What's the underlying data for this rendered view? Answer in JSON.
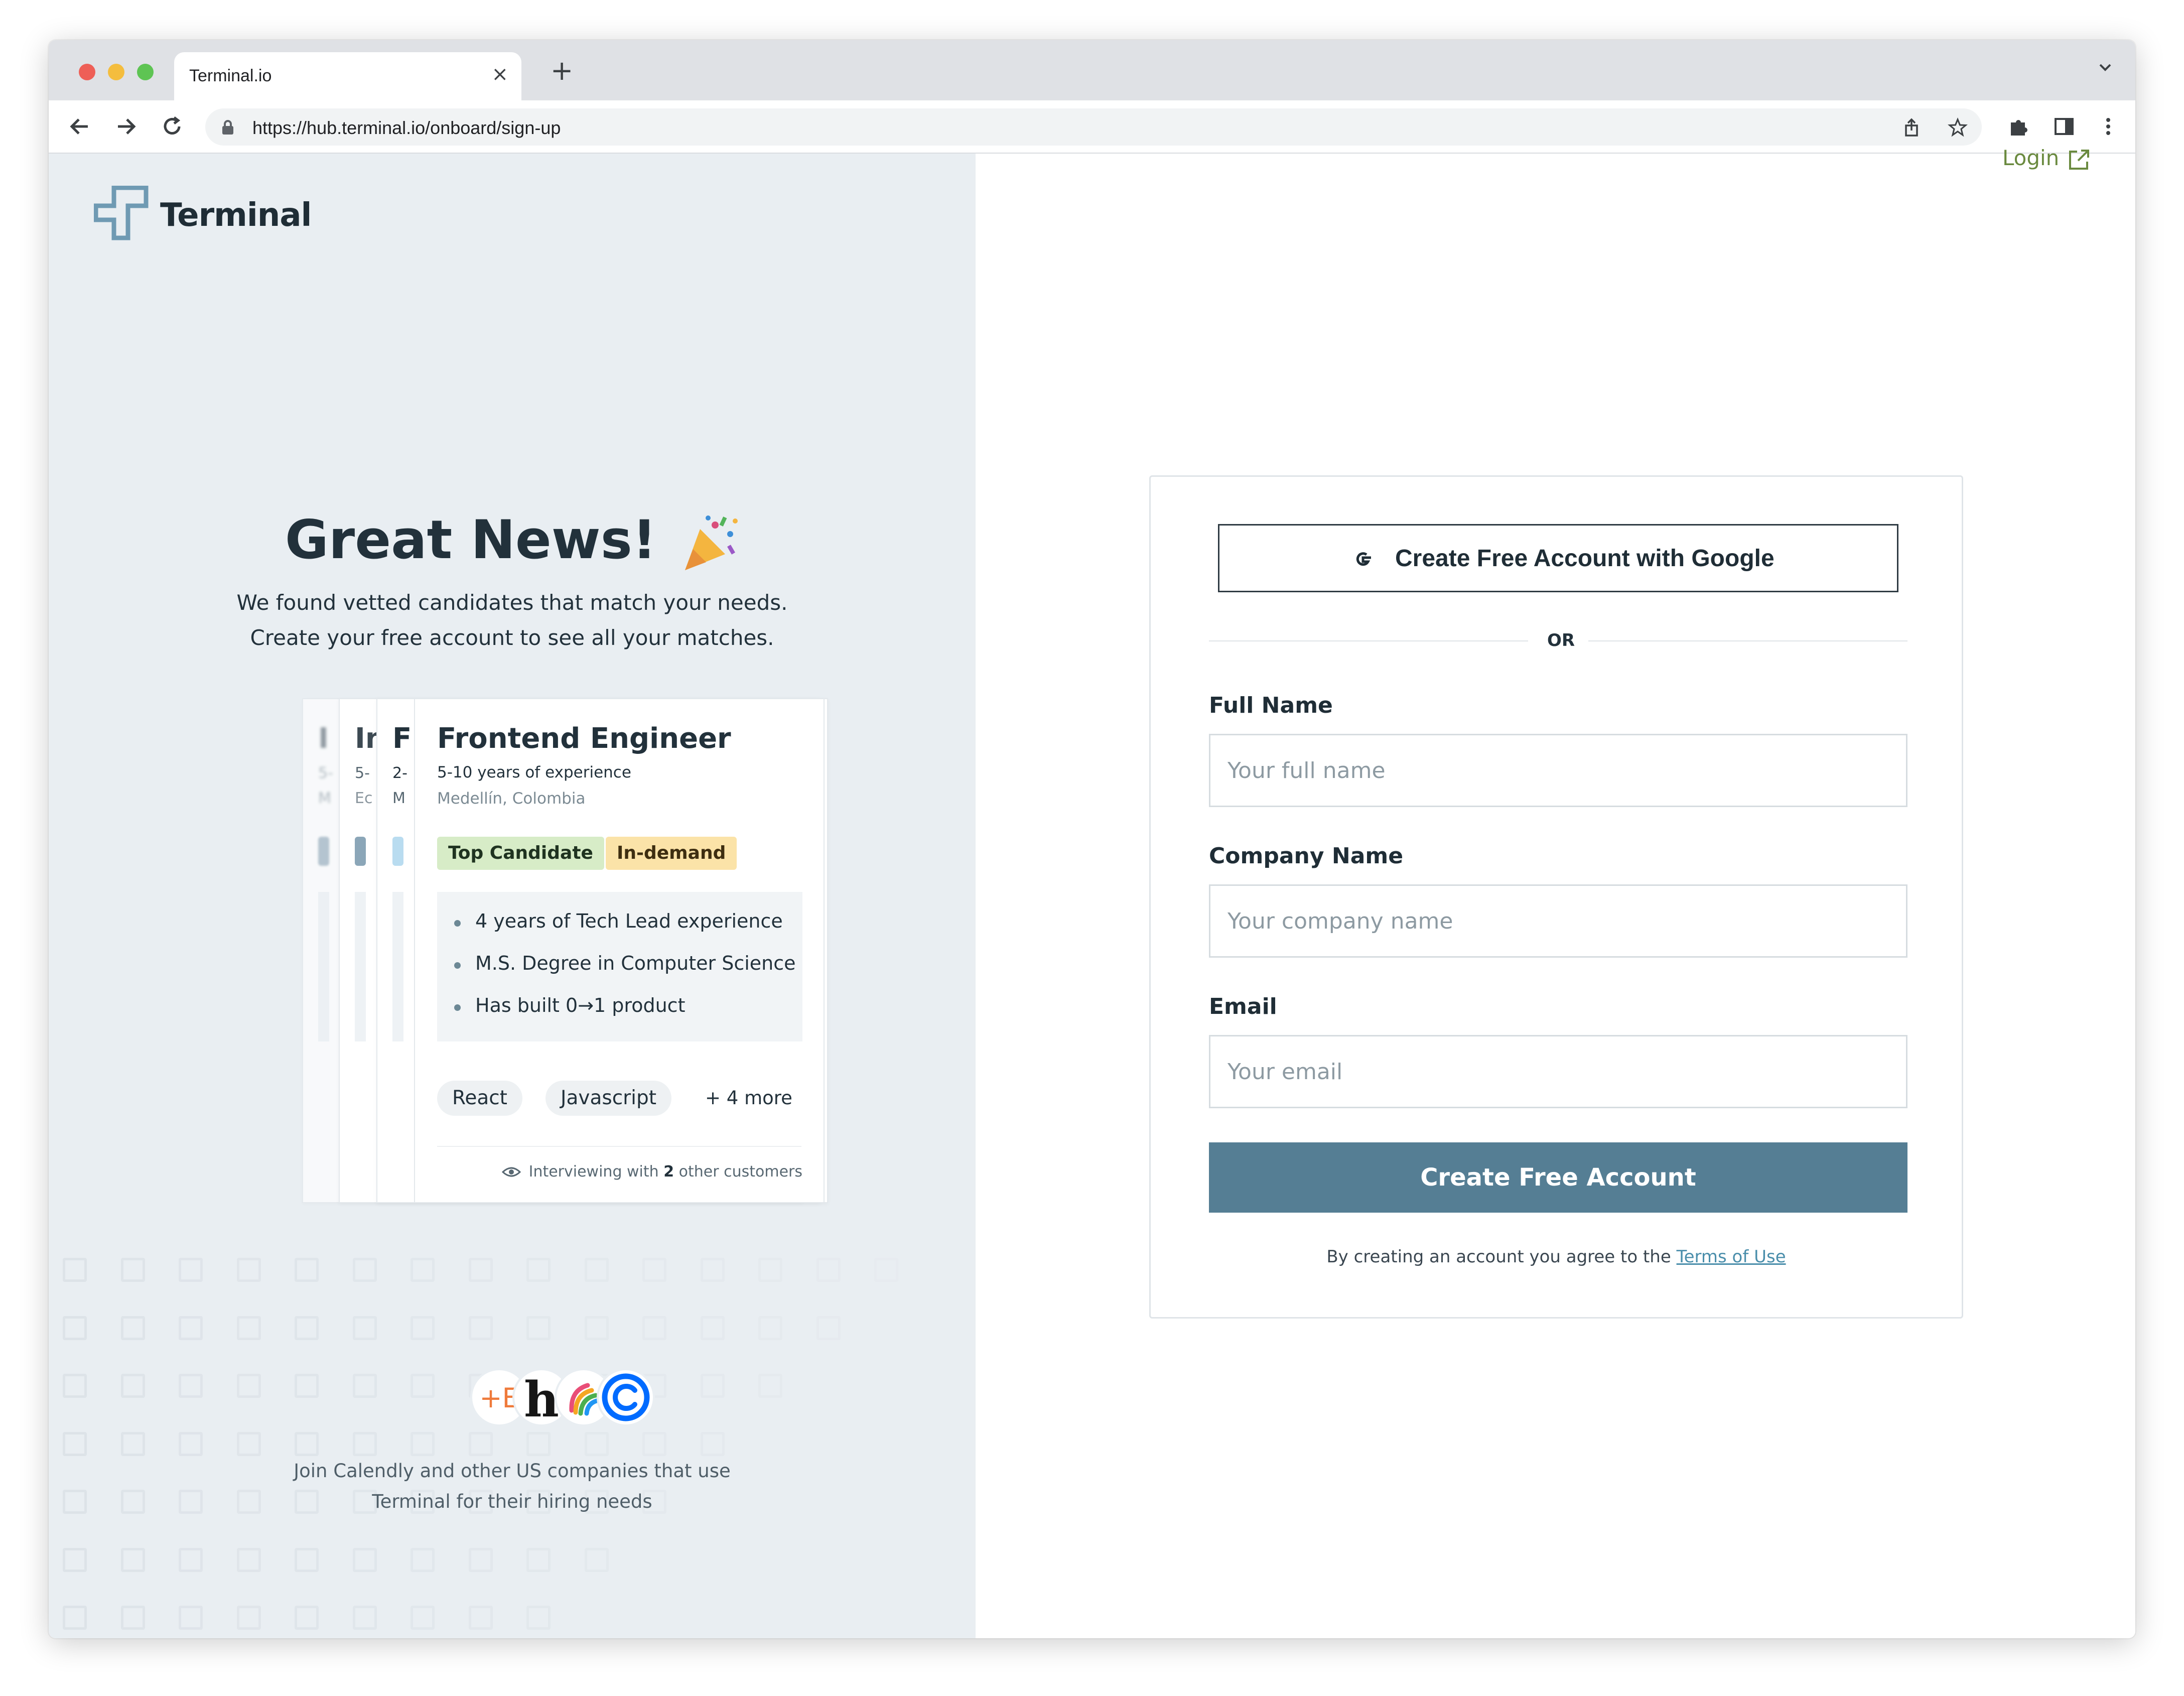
{
  "browser": {
    "tab_title": "Terminal.io",
    "tab_close": "×",
    "new_tab": "+",
    "url": "https://hub.terminal.io/onboard/sign-up"
  },
  "brand": {
    "name": "Terminal"
  },
  "hero": {
    "title": "Great News!",
    "subtitle_line1": "We found vetted candidates that match your needs.",
    "subtitle_line2": "Create your free account to see all your matches."
  },
  "candidate_card": {
    "title": "Frontend Engineer",
    "experience": "5-10 years of experience",
    "location": "Medellín, Colombia",
    "tags": [
      "Top Candidate",
      "In-demand"
    ],
    "highlights": [
      "4 years of Tech Lead experience",
      "M.S. Degree in Computer Science",
      "Has built 0→1 product"
    ],
    "skills": [
      "React",
      "Javascript"
    ],
    "more_skills": "+ 4 more",
    "interviewing_prefix": "Interviewing with",
    "interviewing_count": "2",
    "interviewing_suffix": "other customers"
  },
  "peek_cards": [
    {
      "letter": "F",
      "line1": "2-",
      "line2": "M"
    },
    {
      "letter": "In",
      "line1": "5-",
      "line2": "Ec"
    },
    {
      "letter": "I",
      "line1": "5-",
      "line2": "M"
    }
  ],
  "companies": {
    "text_line1": "Join Calendly and other US companies that use",
    "text_line2": "Terminal for their hiring needs",
    "logos": [
      "+E",
      "h",
      "rainbow-swirl-logo",
      "calendly-logo"
    ]
  },
  "login": {
    "label": "Login"
  },
  "form": {
    "google_label": "Create Free Account with Google",
    "or_label": "OR",
    "full_name_label": "Full Name",
    "full_name_placeholder": "Your full name",
    "company_label": "Company Name",
    "company_placeholder": "Your company name",
    "email_label": "Email",
    "email_placeholder": "Your email",
    "submit_label": "Create Free Account",
    "terms_prefix": "By creating an account you agree to the",
    "terms_link": "Terms of Use"
  },
  "colors": {
    "accent": "#557e94",
    "login_green": "#6a8a3f",
    "tag_green": "#d7ecc7",
    "tag_yellow": "#fbe3a8",
    "left_panel_bg": "#e9eef2"
  }
}
